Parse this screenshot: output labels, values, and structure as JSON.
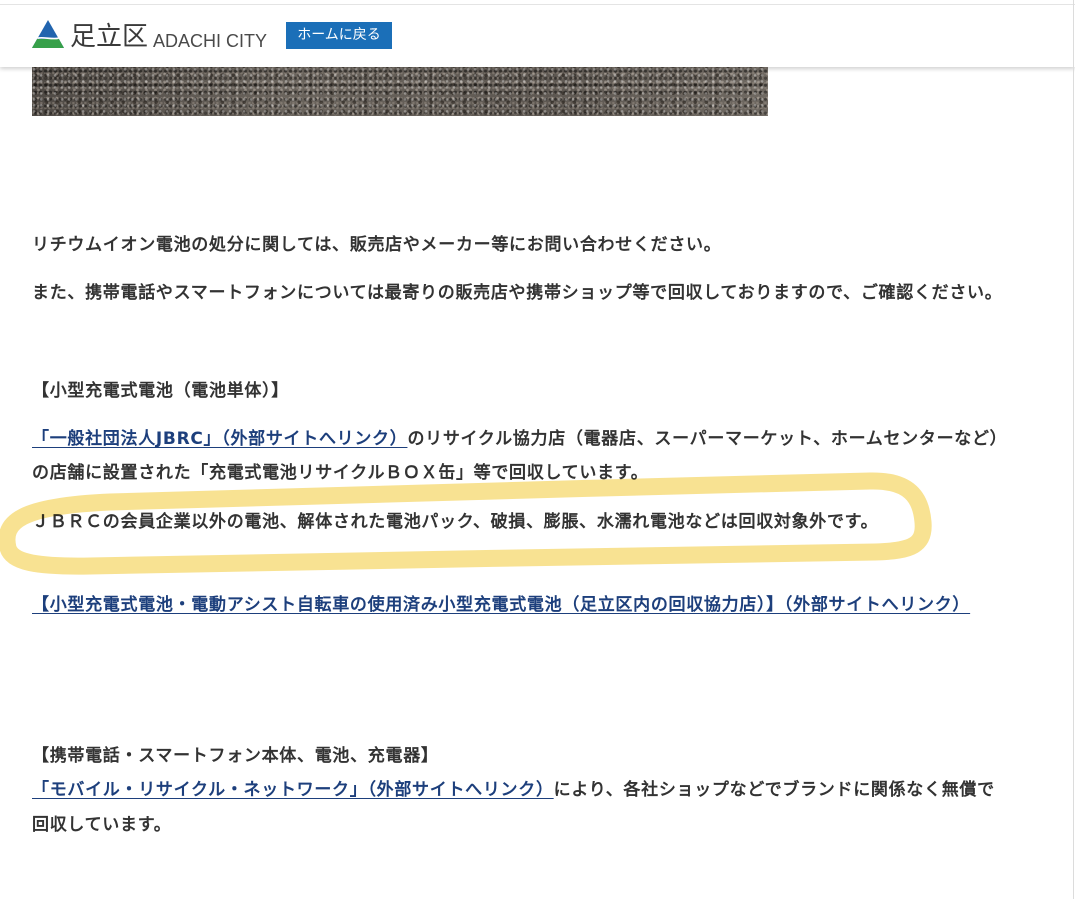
{
  "header": {
    "logo_name": "足立区",
    "logo_sub": "ADACHI CITY",
    "home_button": "ホームに戻る",
    "logo_icon": "adachi-logo-icon"
  },
  "content": {
    "para1": "リチウムイオン電池の処分に関しては、販売店やメーカー等にお問い合わせください。",
    "para2": "また、携帯電話やスマートフォンについては最寄りの販売店や携帯ショップ等で回収しておりますので、ご確認ください。",
    "section1": {
      "heading": "【小型充電式電池（電池単体）】",
      "jbrc_link": "「一般社団法人JBRC」（外部サイトへリンク）",
      "line1_rest": "のリサイクル協力店（電器店、スーパーマーケット、ホームセンターなど）",
      "line2": "の店舗に設置された「充電式電池リサイクルＢＯＸ缶」等で回収しています。",
      "note": "ＪＢＲＣの会員企業以外の電池、解体された電池パック、破損、膨脹、水濡れ電池などは回収対象外です。",
      "stores_link": "【小型充電式電池・電動アシスト自転車の使用済み小型充電式電池（足立区内の回収協力店）】（外部サイトへリンク）"
    },
    "section2": {
      "heading": "【携帯電話・スマートフォン本体、電池、充電器】",
      "mrn_link": "「モバイル・リサイクル・ネットワーク」（外部サイトへリンク）",
      "line1_rest": "により、各社ショップなどでブランドに関係なく無償で",
      "line2": "回収しています。"
    }
  },
  "colors": {
    "accent": "#1b6fb8",
    "link": "#1d3f7c",
    "text": "#333333",
    "highlight": "#f7df86",
    "logo_blue": "#2164ae",
    "logo_green": "#37a04a"
  }
}
